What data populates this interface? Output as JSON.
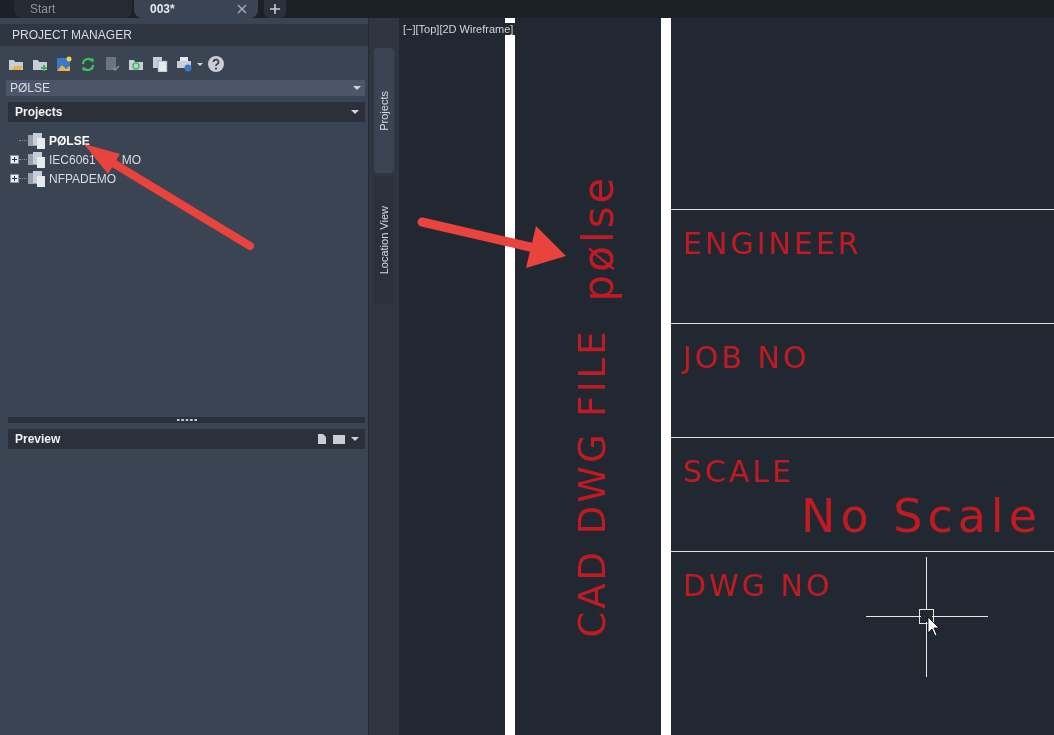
{
  "tabs": [
    {
      "label": "Start",
      "selected": false,
      "closable": false
    },
    {
      "label": "003*",
      "selected": true,
      "closable": true
    }
  ],
  "project_manager": {
    "title": "PROJECT MANAGER",
    "project_dropdown": {
      "value": "PØLSE"
    },
    "projects_header": "Projects",
    "tree": [
      {
        "label": "PØLSE",
        "active": true,
        "expandable": false
      },
      {
        "label": "IEC6061",
        "label_end": "MO",
        "active": false,
        "expandable": true
      },
      {
        "label": "NFPADEMO",
        "active": false,
        "expandable": true
      }
    ],
    "preview_header": "Preview"
  },
  "side_tabs": [
    {
      "label": "Projects",
      "selected": true
    },
    {
      "label": "Location View",
      "selected": false
    }
  ],
  "viewport": {
    "label": "[−][Top][2D Wireframe]",
    "vertical_texts": [
      "pølse",
      "CAD DWG FILE"
    ],
    "title_block": [
      {
        "label": "ENGINEER"
      },
      {
        "label": "JOB NO"
      },
      {
        "label": "SCALE",
        "value": "No Scale"
      },
      {
        "label": "DWG NO"
      }
    ]
  }
}
